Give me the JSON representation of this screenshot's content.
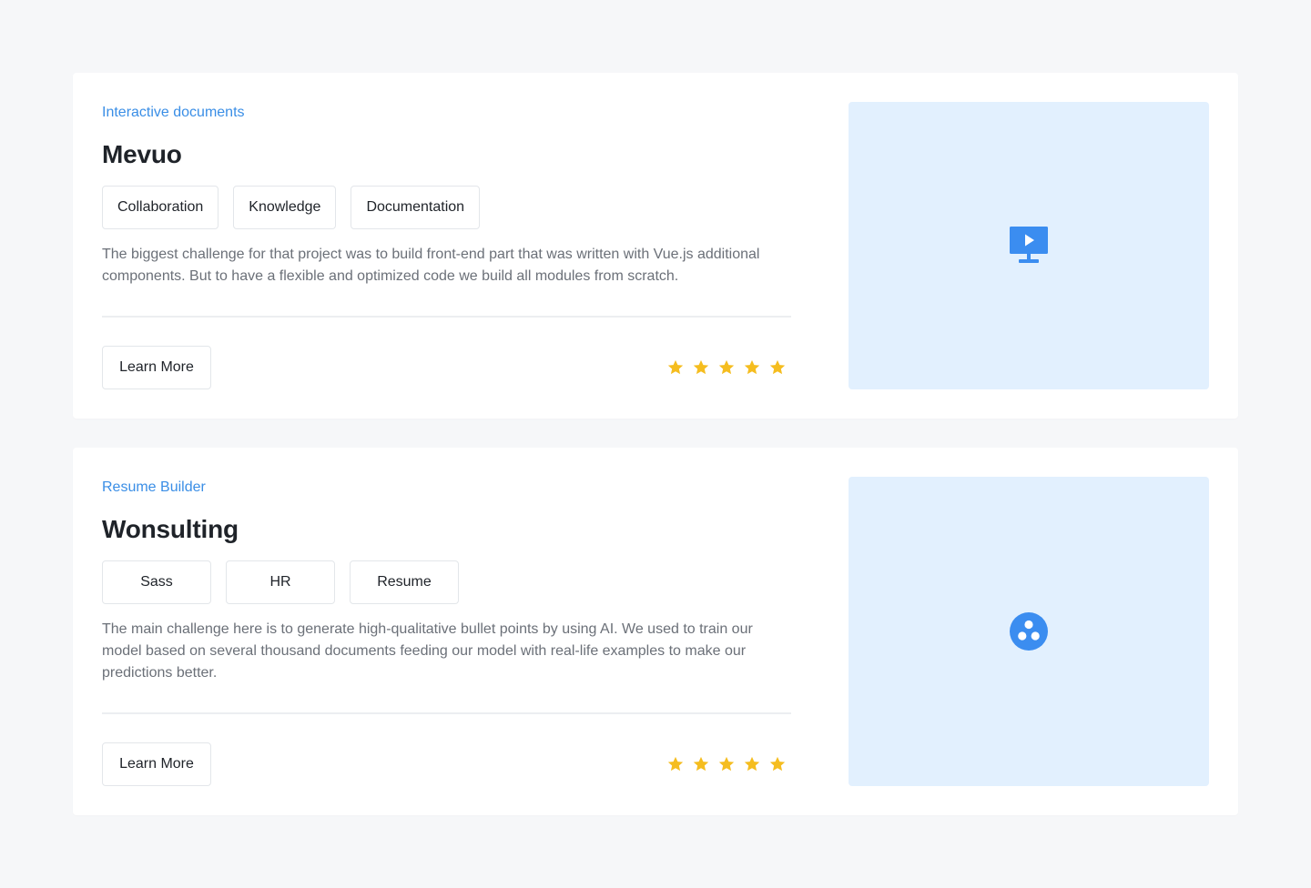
{
  "colors": {
    "accent": "#3a8ee6",
    "icon_blue": "#3b8df0",
    "star": "#f5bd1f",
    "media_bg": "#e2f0fe",
    "page_bg": "#f6f7f9"
  },
  "projects": [
    {
      "category": "Interactive documents",
      "title": "Mevuo",
      "tags": [
        "Collaboration",
        "Knowledge",
        "Documentation"
      ],
      "description": "The biggest challenge for that project was to build front-end part that was written with Vue.js additional components. But to have a flexible and optimized code we build all modules from scratch.",
      "button_label": "Learn More",
      "rating": 5,
      "media_icon": "presentation-play-icon"
    },
    {
      "category": "Resume Builder",
      "title": "Wonsulting",
      "tags": [
        "Sass",
        "HR",
        "Resume"
      ],
      "description": "The main challenge here is to generate high-qualitative bullet points by using AI. We used to train our model based on several thousand documents feeding our model with real-life examples to make our predictions better.",
      "button_label": "Learn More",
      "rating": 5,
      "media_icon": "three-dots-circle-icon"
    }
  ]
}
